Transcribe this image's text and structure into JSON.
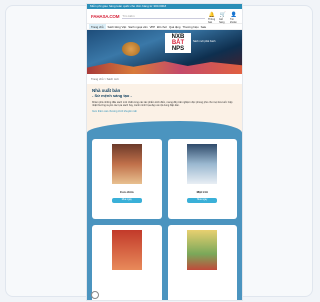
{
  "topbar": {
    "text": "Miễn phí giao hàng toàn quốc cho đơn hàng từ 300.000đ"
  },
  "header": {
    "logo": "FAHASA.COM",
    "search_placeholder": "Tìm kiếm",
    "icons": [
      {
        "name": "notification-icon",
        "glyph": "🔔",
        "label": "Thông báo"
      },
      {
        "name": "cart-icon",
        "glyph": "🛒",
        "label": "Giỏ hàng"
      },
      {
        "name": "account-icon",
        "glyph": "👤",
        "label": "Tài khoản"
      }
    ]
  },
  "nav": {
    "items": [
      "Trang chủ",
      "Sách tiếng Việt",
      "Sách ngoại văn",
      "VPP",
      "Đồ chơi",
      "Quà tặng",
      "Thương hiệu",
      "Sale"
    ]
  },
  "banner": {
    "title_line1": "NXB",
    "title_line2": "BẮT",
    "title_line3": "NPS",
    "subtitle": "Sách mới phát hành"
  },
  "breadcrumb": "Trang chủ > Sách mới",
  "intro": {
    "heading": "Nhà xuất bản",
    "subheading": "- Sứ mệnh sáng tạo -",
    "paragraph": "Khám phá những đầu sách mới nhất cùng các tác phẩm kinh điển, mang đến trải nghiệm đọc phong phú cho mọi lứa tuổi. Cập nhật thường xuyên các tựa sách hay, tranh minh họa đẹp và nội dung hấp dẫn.",
    "link": "Xem thêm các chương trình khuyến mãi"
  },
  "products": [
    {
      "name": "Con chim",
      "button": "Mua ngay",
      "cover": "a"
    },
    {
      "name": "Mặt trời",
      "button": "Mua ngay",
      "cover": "b"
    },
    {
      "name": "",
      "button": "",
      "cover": "c"
    },
    {
      "name": "",
      "button": "",
      "cover": "d"
    }
  ],
  "colors": {
    "accent": "#2b8fb8",
    "brand_red": "#d7263d",
    "panel_blue": "#4b94bf",
    "intro_bg": "#fbf1e6"
  }
}
